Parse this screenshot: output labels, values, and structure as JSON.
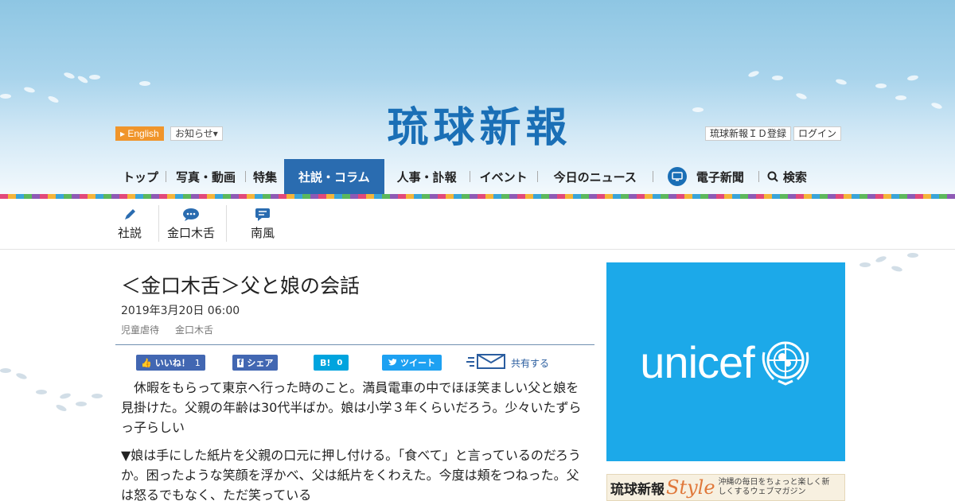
{
  "header": {
    "logo": "琉球新報",
    "lang_button": "English",
    "notice_button": "お知らせ▾",
    "id_register": "琉球新報ＩＤ登録",
    "login": "ログイン"
  },
  "nav": {
    "items": [
      {
        "label": "トップ",
        "active": false
      },
      {
        "label": "写真・動画",
        "active": false
      },
      {
        "label": "特集",
        "active": false
      },
      {
        "label": "社説・コラム",
        "active": true
      },
      {
        "label": "人事・訃報",
        "active": false
      },
      {
        "label": "イベント",
        "active": false
      },
      {
        "label": "今日のニュース",
        "active": false
      },
      {
        "label": "電子新聞",
        "active": false
      },
      {
        "label": "検索",
        "active": false
      }
    ]
  },
  "subnav": {
    "items": [
      {
        "label": "社説",
        "icon": "pen-icon"
      },
      {
        "label": "金口木舌",
        "icon": "speech-bubble-icon"
      },
      {
        "label": "南風",
        "icon": "comment-icon"
      }
    ]
  },
  "article": {
    "title": "＜金口木舌＞父と娘の会話",
    "date": "2019年3月20日 06:00",
    "tags": [
      "児童虐待",
      "金口木舌"
    ],
    "paragraphs": [
      "　休暇をもらって東京へ行った時のこと。満員電車の中でほほ笑ましい父と娘を見掛けた。父親の年齢は30代半ばか。娘は小学３年くらいだろう。少々いたずらっ子らしい",
      "▼娘は手にした紙片を父親の口元に押し付ける。「食べて」と言っているのだろうか。困ったような笑顔を浮かべ、父は紙片をくわえた。今度は頬をつねった。父は怒るでもなく、ただ笑っている"
    ]
  },
  "share": {
    "like_label": "いいね！",
    "like_count": "1",
    "facebook_share": "シェア",
    "hatena_label": "B!",
    "hatena_count": "0",
    "tweet_label": "ツイート",
    "mail_share": "共有する"
  },
  "sidebar": {
    "ad_text": "unicef",
    "banner_name": "琉球新報",
    "banner_style": "Style",
    "banner_tagline": "沖縄の毎日をちょっと楽しく新しくするウェブマガジン"
  },
  "colors": {
    "brand_blue": "#1a6fb6",
    "nav_active": "#2a6cb0",
    "english_orange": "#f0952b",
    "unicef_blue": "#1ca9e9",
    "facebook_blue": "#4267b2",
    "twitter_blue": "#1da1f2",
    "hatena_blue": "#00a4de"
  }
}
